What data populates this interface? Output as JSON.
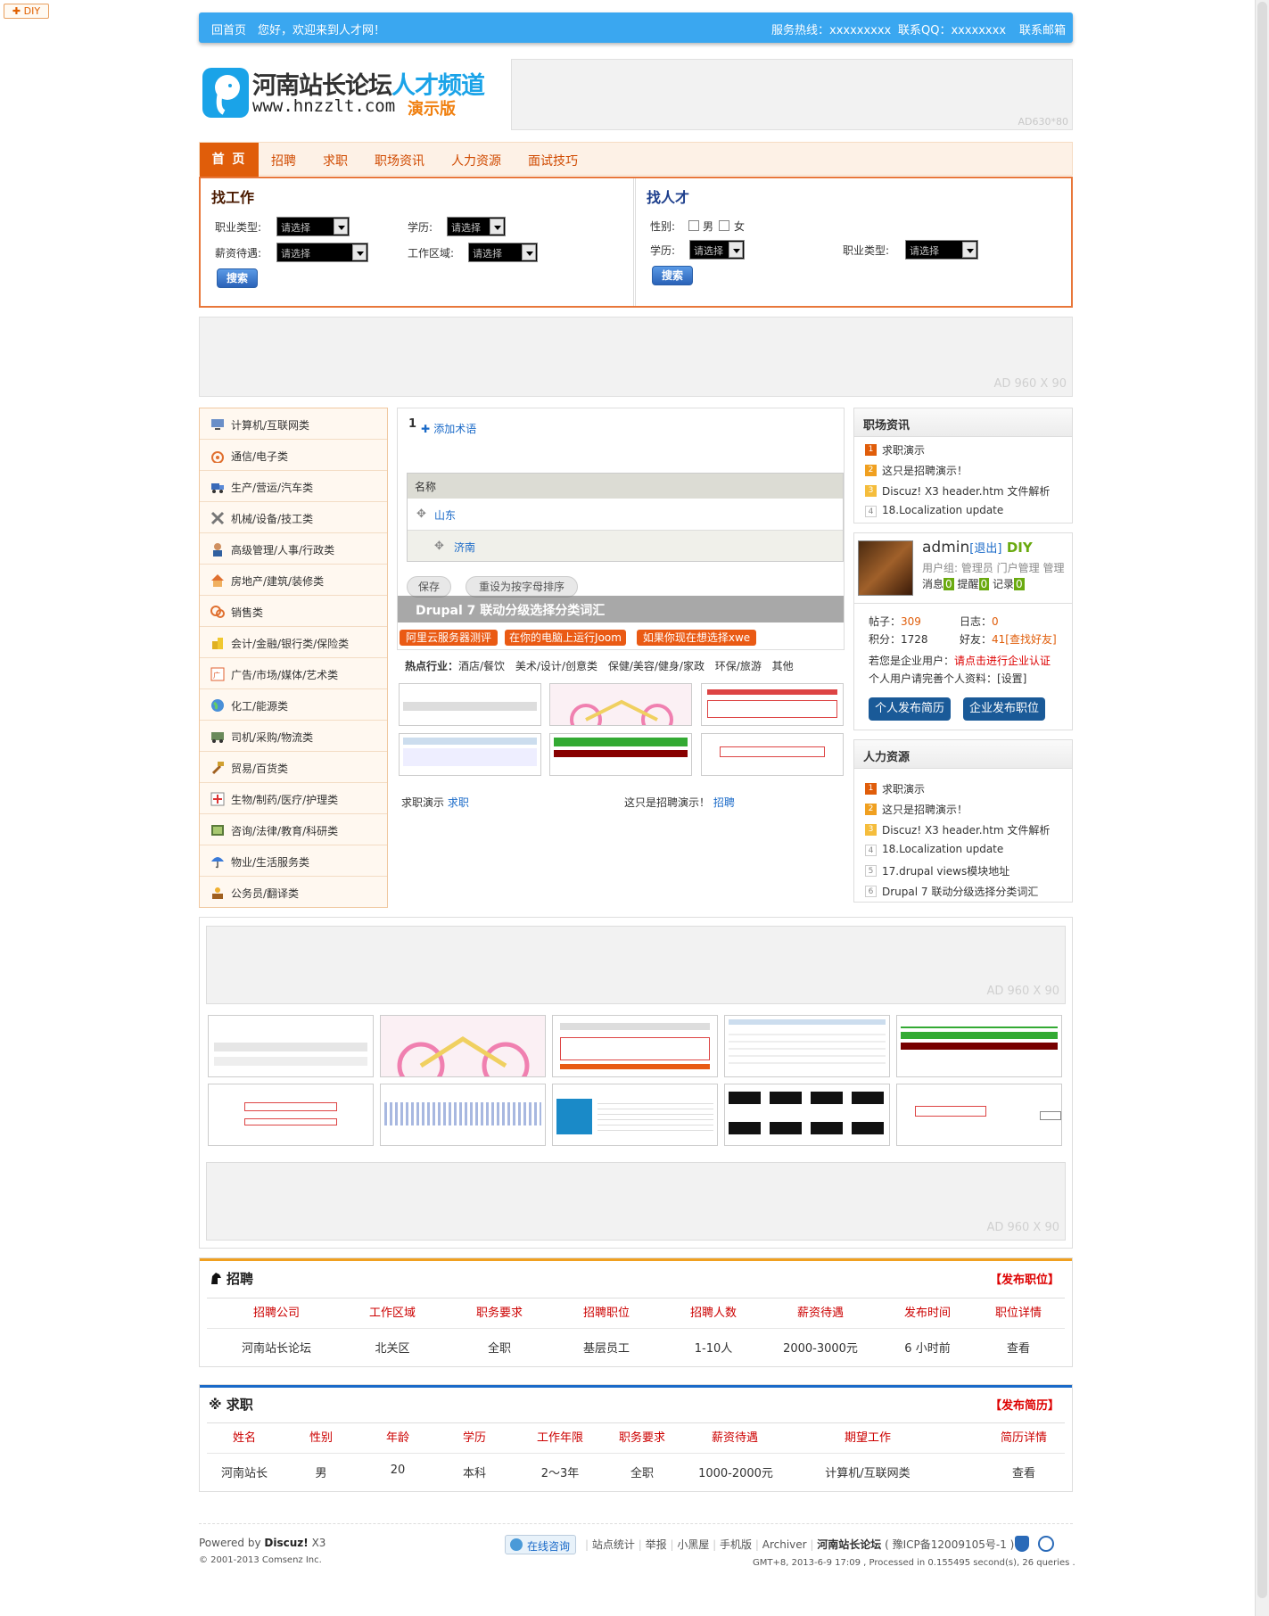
{
  "diy_tab": "✚ DIY",
  "topbar": {
    "home": "回首页",
    "welcome": "您好，欢迎来到人才网！",
    "hotline": "服务热线：xxxxxxxxx",
    "qq": "联系QQ：xxxxxxxx",
    "email": "联系邮箱"
  },
  "logo": {
    "line1a": "河南站长论坛",
    "line1b": "人才频道",
    "line2": "www.hnzzlt.com",
    "badge": "演示版"
  },
  "ads": {
    "top": "AD630*80",
    "wide": "AD 960 X 90"
  },
  "nav": [
    "首 页",
    "招聘",
    "求职",
    "职场资讯",
    "人力资源",
    "面试技巧"
  ],
  "find_job": {
    "title": "找工作",
    "job_type": "职业类型:",
    "education": "学历:",
    "salary": "薪资待遇:",
    "area": "工作区域:",
    "select_placeholder": "请选择",
    "search": "搜索"
  },
  "find_talent": {
    "title": "找人才",
    "gender": "性别:",
    "male": "男",
    "female": "女",
    "education": "学历:",
    "job_type": "职业类型:",
    "select_placeholder": "请选择",
    "search": "搜索"
  },
  "categories": [
    "计算机/互联网类",
    "通信/电子类",
    "生产/营运/汽车类",
    "机械/设备/技工类",
    "高级管理/人事/行政类",
    "房地产/建筑/装修类",
    "销售类",
    "会计/金融/银行类/保险类",
    "广告/市场/媒体/艺术类",
    "化工/能源类",
    "司机/采购/物流类",
    "贸易/百货类",
    "生物/制药/医疗/护理类",
    "咨询/法律/教育/科研类",
    "物业/生活服务类",
    "公务员/翻译类"
  ],
  "slide": {
    "num": "1",
    "add_term": "添加术语",
    "col_name": "名称",
    "row1": "山东",
    "row2": "济南",
    "btn_save": "保存",
    "btn_reset": "重设为按字母排序",
    "caption": "Drupal 7 联动分级选择分类词汇"
  },
  "tags": [
    "阿里云服务器测评",
    "在你的电脑上运行Joom",
    "如果你现在想选择xwe"
  ],
  "hot": {
    "label": "热点行业：",
    "items": [
      "酒店/餐饮",
      "美术/设计/创意类",
      "保健/美容/健身/家政",
      "环保/旅游",
      "其他"
    ]
  },
  "mid_links": [
    {
      "text": "求职演示",
      "tag": "求职"
    },
    {
      "text": "这只是招聘演示！",
      "tag": "招聘"
    }
  ],
  "news1": {
    "title": "职场资讯",
    "items": [
      "求职演示",
      "这只是招聘演示！",
      "Discuz! X3 header.htm 文件解析",
      "18.Localization update"
    ]
  },
  "user": {
    "name": "admin",
    "logout": "[退出]",
    "diy": "DIY",
    "group": "用户组: 管理员 门户管理 管理",
    "msg_label": "消息",
    "msg": "0",
    "remind_label": "提醒",
    "remind": "0",
    "record_label": "记录",
    "record": "0",
    "posts_label": "帖子：",
    "posts": "309",
    "logs_label": "日志：",
    "logs": "0",
    "points_label": "积分：",
    "points": "1728",
    "friends_label": "好友：",
    "friends": "41[查找好友]",
    "company_q": "若您是企业用户：",
    "company_link": "请点击进行企业认证",
    "personal": "个人用户请完善个人资料：[设置]",
    "btn_resume": "个人发布简历",
    "btn_job": "企业发布职位"
  },
  "news2": {
    "title": "人力资源",
    "items": [
      "求职演示",
      "这只是招聘演示！",
      "Discuz! X3 header.htm 文件解析",
      "18.Localization update",
      "17.drupal views模块地址",
      "Drupal 7 联动分级选择分类词汇"
    ]
  },
  "recruit": {
    "title": "招聘",
    "action": "【发布职位】",
    "headers": [
      "招聘公司",
      "工作区域",
      "职务要求",
      "招聘职位",
      "招聘人数",
      "薪资待遇",
      "发布时间",
      "职位详情"
    ],
    "row": [
      "河南站长论坛",
      "北关区",
      "全职",
      "基层员工",
      "1-10人",
      "2000-3000元",
      "6 小时前",
      "查看"
    ]
  },
  "seek": {
    "title": "※ 求职",
    "action": "【发布简历】",
    "headers": [
      "姓名",
      "性别",
      "年龄",
      "学历",
      "工作年限",
      "职务要求",
      "薪资待遇",
      "期望工作",
      "简历详情"
    ],
    "row": [
      "河南站长",
      "男",
      "20",
      "本科",
      "2～3年",
      "全职",
      "1000-2000元",
      "计算机/互联网类",
      "查看"
    ]
  },
  "footer": {
    "powered": "Powered by",
    "brand": "Discuz!",
    "ver": "X3",
    "copy": "© 2001-2013 Comsenz Inc.",
    "consult": "在线咨询",
    "links": [
      "站点统计",
      "举报",
      "小黑屋",
      "手机版",
      "Archiver"
    ],
    "site": "河南站长论坛",
    "icp": "( 豫ICP备12009105号-1 )",
    "stats": "GMT+8, 2013-6-9 17:09 , Processed in 0.155495 second(s), 26 queries ."
  }
}
